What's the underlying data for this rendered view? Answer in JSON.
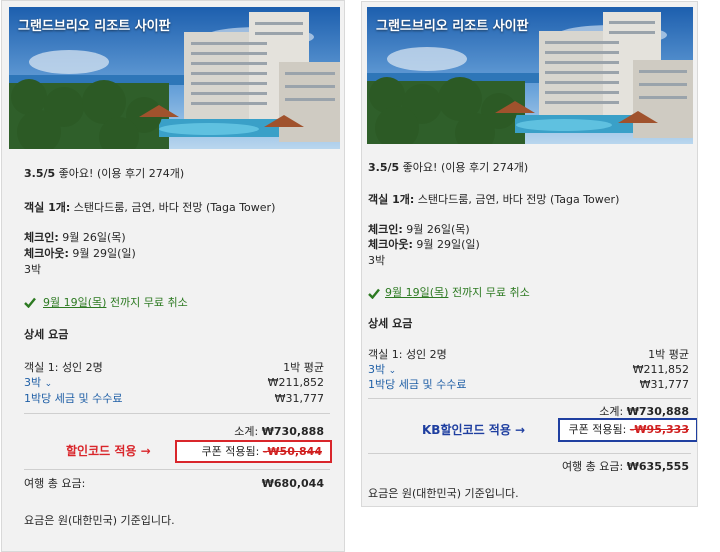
{
  "left": {
    "hotel_name": "그랜드브리오 리조트 사이판",
    "rating_score": "3.5/5",
    "rating_label": "좋아요!",
    "review_count": "(이용 후기 274개)",
    "room_label": "객실 1개:",
    "room_desc": "스탠다드룸, 금연, 바다 전망 (Taga Tower)",
    "checkin_label": "체크인:",
    "checkin_date": "9월 26일(목)",
    "checkout_label": "체크아웃:",
    "checkout_date": "9월 29일(일)",
    "nights": "3박",
    "cancel_date": "9월 19일(목)",
    "cancel_text": "전까지 무료 취소",
    "detail_title": "상세 요금",
    "room_guests": "객실 1: 성인 2명",
    "per_night_avg": "1박 평균",
    "nights_link": "3박",
    "nights_price": "₩211,852",
    "tax_link": "1박당 세금 및 수수료",
    "tax_price": "₩31,777",
    "subtotal_label": "소계:",
    "subtotal_value": "₩730,888",
    "coupon_label": "쿠폰 적용됨:",
    "coupon_value": "-₩50,844",
    "callout": "할인코드 적용 →",
    "total_label": "여행 총 요금:",
    "total_value": "₩680,044",
    "currency_note": "요금은 원(대한민국) 기준입니다."
  },
  "right": {
    "hotel_name": "그랜드브리오 리조트 사이판",
    "rating_score": "3.5/5",
    "rating_label": "좋아요!",
    "review_count": "(이용 후기 274개)",
    "room_label": "객실 1개:",
    "room_desc": "스탠다드룸, 금연, 바다 전망 (Taga Tower)",
    "checkin_label": "체크인:",
    "checkin_date": "9월 26일(목)",
    "checkout_label": "체크아웃:",
    "checkout_date": "9월 29일(일)",
    "nights": "3박",
    "cancel_date": "9월 19일(목)",
    "cancel_text": "전까지 무료 취소",
    "detail_title": "상세 요금",
    "room_guests": "객실 1: 성인 2명",
    "per_night_avg": "1박 평균",
    "nights_link": "3박",
    "nights_price": "₩211,852",
    "tax_link": "1박당 세금 및 수수료",
    "tax_price": "₩31,777",
    "subtotal_label": "소계:",
    "subtotal_value": "₩730,888",
    "coupon_label": "쿠폰 적용됨:",
    "coupon_value": "-₩95,333",
    "callout": "KB할인코드 적용 →",
    "total_label": "여행 총 요금:",
    "total_value": "₩635,555",
    "currency_note": "요금은 원(대한민국) 기준입니다."
  },
  "colors": {
    "left_highlight": "#d9262b",
    "right_highlight": "#1f3fa0",
    "link": "#1f5fa6",
    "cancel_green": "#2d7a22"
  },
  "icons": {
    "cancel_check": "check-icon",
    "nights_expand": "chevron-down-icon"
  }
}
